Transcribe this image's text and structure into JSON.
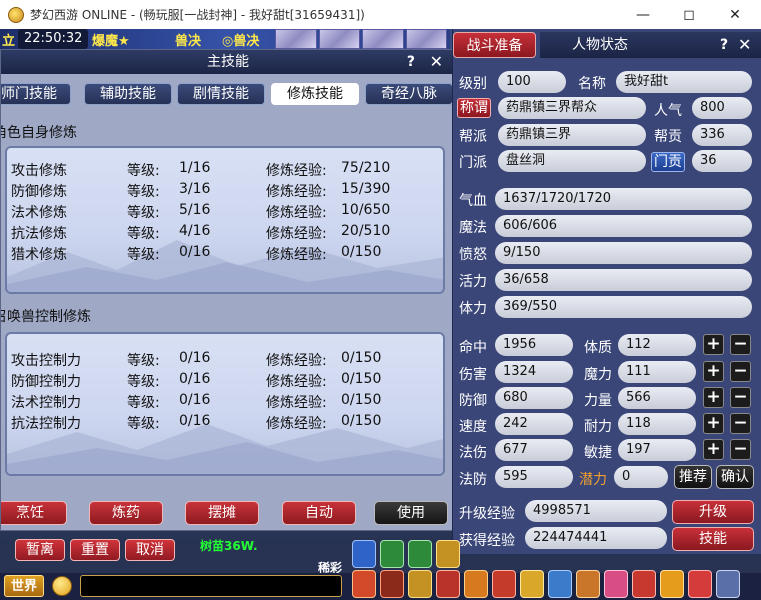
{
  "window": {
    "title": "梦幻西游 ONLINE - (畅玩服[一战封神] - 我好甜t[31659431])",
    "minimize_icon": "minimize-icon",
    "maximize_icon": "maximize-icon",
    "close_icon": "close-icon"
  },
  "hud": {
    "clock": "22:50:32",
    "strip_texts": [
      "立",
      "爆魔★",
      "兽决",
      "◎兽决"
    ],
    "near_bottom": [
      "树苗36W.",
      "稀彩"
    ]
  },
  "skill_panel": {
    "title": "主技能",
    "help": "?",
    "close": "✕",
    "tabs": [
      {
        "label": "师门技能",
        "active": false
      },
      {
        "label": "辅助技能",
        "active": false
      },
      {
        "label": "剧情技能",
        "active": false
      },
      {
        "label": "修炼技能",
        "active": true
      },
      {
        "label": "奇经八脉",
        "active": false
      }
    ],
    "self_section": {
      "title": "角色自身修炼",
      "rows": [
        {
          "name": "攻击修炼",
          "level_label": "等级:",
          "level": "1/16",
          "exp_label": "修炼经验:",
          "exp": "75/210"
        },
        {
          "name": "防御修炼",
          "level_label": "等级:",
          "level": "3/16",
          "exp_label": "修炼经验:",
          "exp": "15/390"
        },
        {
          "name": "法术修炼",
          "level_label": "等级:",
          "level": "5/16",
          "exp_label": "修炼经验:",
          "exp": "10/650"
        },
        {
          "name": "抗法修炼",
          "level_label": "等级:",
          "level": "4/16",
          "exp_label": "修炼经验:",
          "exp": "20/510"
        },
        {
          "name": "猎术修炼",
          "level_label": "等级:",
          "level": "0/16",
          "exp_label": "修炼经验:",
          "exp": "0/150"
        }
      ]
    },
    "pet_section": {
      "title": "召唤兽控制修炼",
      "rows": [
        {
          "name": "攻击控制力",
          "level_label": "等级:",
          "level": "0/16",
          "exp_label": "修炼经验:",
          "exp": "0/150"
        },
        {
          "name": "防御控制力",
          "level_label": "等级:",
          "level": "0/16",
          "exp_label": "修炼经验:",
          "exp": "0/150"
        },
        {
          "name": "法术控制力",
          "level_label": "等级:",
          "level": "0/16",
          "exp_label": "修炼经验:",
          "exp": "0/150"
        },
        {
          "name": "抗法控制力",
          "level_label": "等级:",
          "level": "0/16",
          "exp_label": "修炼经验:",
          "exp": "0/150"
        }
      ]
    },
    "buttons": [
      "烹饪",
      "炼药",
      "摆摊",
      "自动",
      "使用"
    ]
  },
  "bottom_buttons": [
    "暂离",
    "重置",
    "取消"
  ],
  "chat": {
    "channel": "世界"
  },
  "status_panel": {
    "battle_tab": "战斗准备",
    "title": "人物状态",
    "help": "?",
    "close": "✕",
    "level_label": "级别",
    "level": "100",
    "name_label": "名称",
    "name": "我好甜t",
    "title_label": "称谓",
    "title_value": "药鼎镇三界帮众",
    "popularity_label": "人气",
    "popularity": "800",
    "guild_label": "帮派",
    "guild": "药鼎镇三界",
    "guild_contrib_label": "帮贡",
    "guild_contrib": "336",
    "school_label": "门派",
    "school": "盘丝洞",
    "school_contrib_label": "门贡",
    "school_contrib": "36",
    "hp_label": "气血",
    "hp": "1637/1720/1720",
    "mp_label": "魔法",
    "mp": "606/606",
    "anger_label": "愤怒",
    "anger": "9/150",
    "vitality_label": "活力",
    "vitality": "36/658",
    "stamina_label": "体力",
    "stamina": "369/550",
    "stats": [
      {
        "label": "命中",
        "value": "1956",
        "attr_label": "体质",
        "attr_value": "112"
      },
      {
        "label": "伤害",
        "value": "1324",
        "attr_label": "魔力",
        "attr_value": "111"
      },
      {
        "label": "防御",
        "value": "680",
        "attr_label": "力量",
        "attr_value": "566"
      },
      {
        "label": "速度",
        "value": "242",
        "attr_label": "耐力",
        "attr_value": "118"
      },
      {
        "label": "法伤",
        "value": "677",
        "attr_label": "敏捷",
        "attr_value": "197"
      }
    ],
    "magic_def_label": "法防",
    "magic_def": "595",
    "potential_label": "潜力",
    "potential": "0",
    "recommend": "推荐",
    "confirm": "确认",
    "upgrade_exp_label": "升级经验",
    "upgrade_exp": "4998571",
    "gained_exp_label": "获得经验",
    "gained_exp": "224474441",
    "upgrade_button": "升级",
    "skills_button": "技能",
    "plus": "+",
    "minus": "−"
  }
}
